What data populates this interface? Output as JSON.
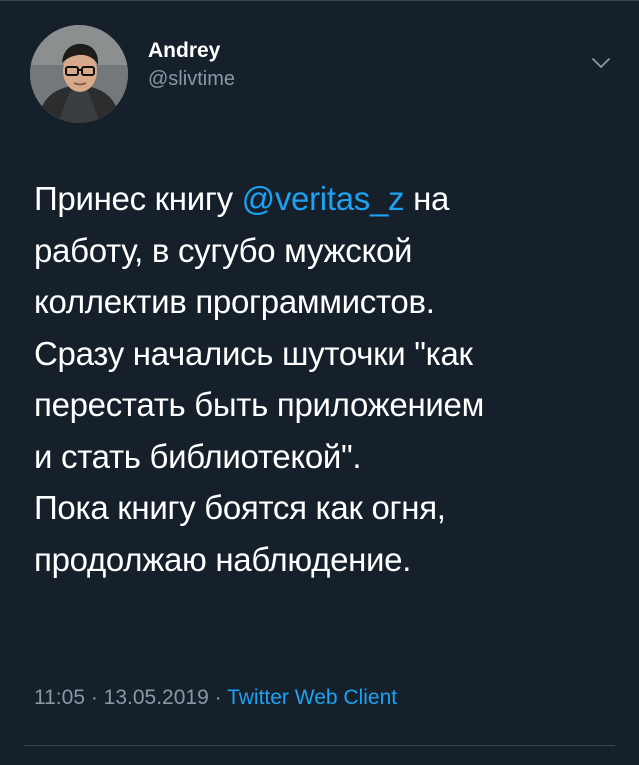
{
  "user": {
    "display_name": "Andrey",
    "handle": "@slivtime"
  },
  "tweet": {
    "segments": [
      {
        "before": "Принес книгу ",
        "mention": "@veritas_z",
        "after": " на"
      },
      {
        "text": "работу, в сугубо мужской"
      },
      {
        "text": "коллектив программистов."
      },
      {
        "text": "Сразу начались шуточки \"как"
      },
      {
        "text": "перестать быть приложением"
      },
      {
        "text": "и стать библиотекой\"."
      },
      {
        "text": "Пока книгу боятся как огня,"
      },
      {
        "text": "продолжаю наблюдение."
      }
    ],
    "time": "11:05",
    "date": "13.05.2019",
    "separator": " · ",
    "source": "Twitter Web Client"
  },
  "icons": {
    "menu": "chevron-down-icon"
  },
  "colors": {
    "background": "#15202b",
    "link": "#1da1f2",
    "secondary_text": "#8899a6",
    "divider": "#38444d"
  }
}
